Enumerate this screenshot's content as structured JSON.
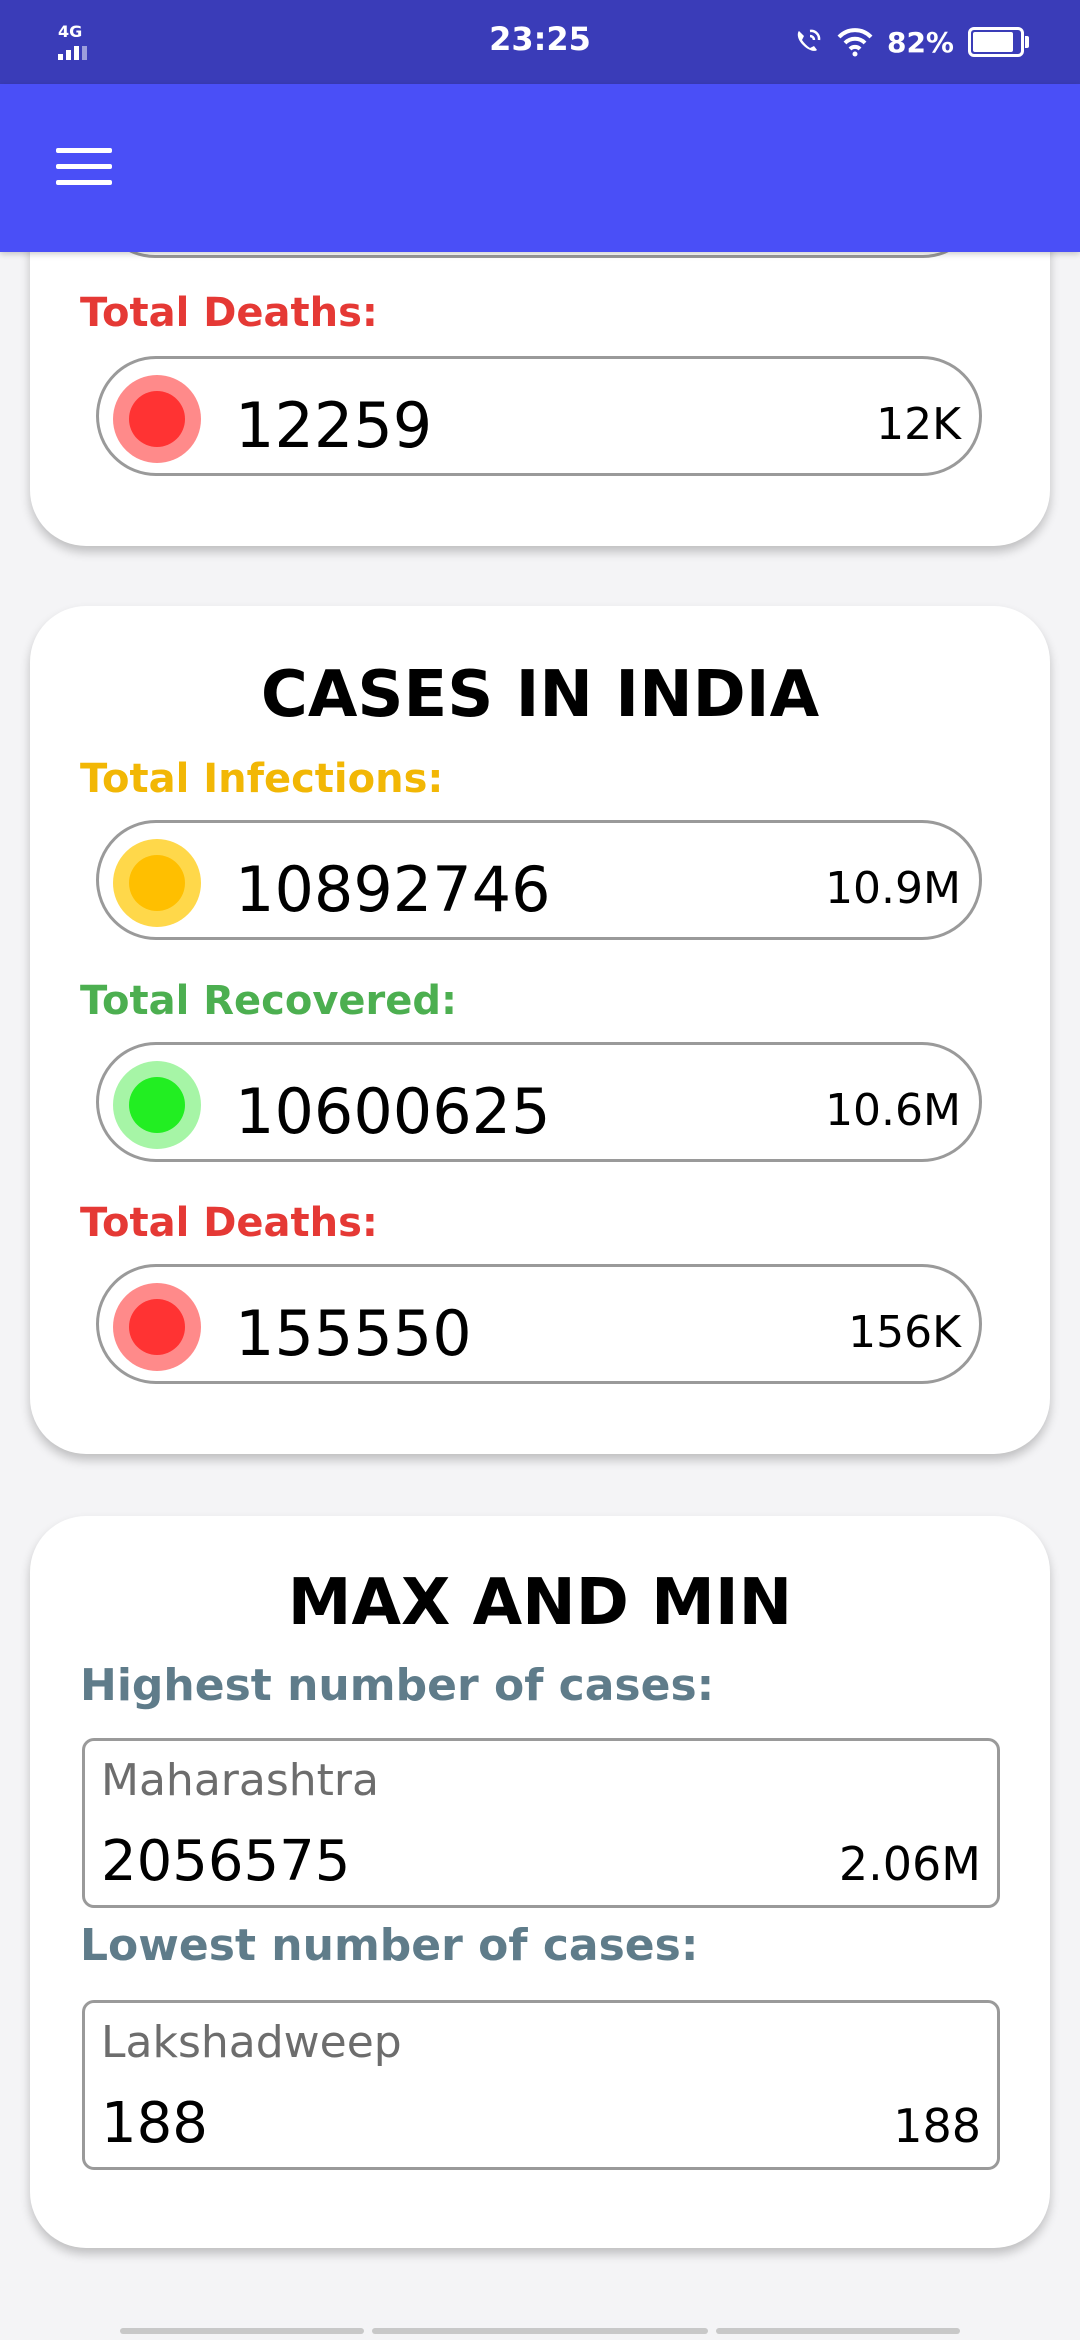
{
  "status_bar": {
    "network": "4G",
    "time": "23:25",
    "battery": "82%"
  },
  "top_card": {
    "deaths_label": "Total Deaths:",
    "deaths_value": "12259",
    "deaths_short": "12K"
  },
  "india_card": {
    "title": "CASES IN INDIA",
    "infections_label": "Total Infections:",
    "infections_value": "10892746",
    "infections_short": "10.9M",
    "recovered_label": "Total Recovered:",
    "recovered_value": "10600625",
    "recovered_short": "10.6M",
    "deaths_label": "Total Deaths:",
    "deaths_value": "155550",
    "deaths_short": "156K"
  },
  "maxmin_card": {
    "title": "MAX AND MIN",
    "highest_label": "Highest number of cases:",
    "highest_state": "Maharashtra",
    "highest_value": "2056575",
    "highest_short": "2.06M",
    "lowest_label": "Lowest number of cases:",
    "lowest_state": "Lakshadweep",
    "lowest_value": "188",
    "lowest_short": "188"
  },
  "colors": {
    "appbar": "#4a4ff7",
    "statusbar": "#3a3cb8",
    "infections": "#f2b705",
    "recovered": "#4caf50",
    "deaths": "#e53935",
    "maxmin_label": "#5f7c8a"
  }
}
